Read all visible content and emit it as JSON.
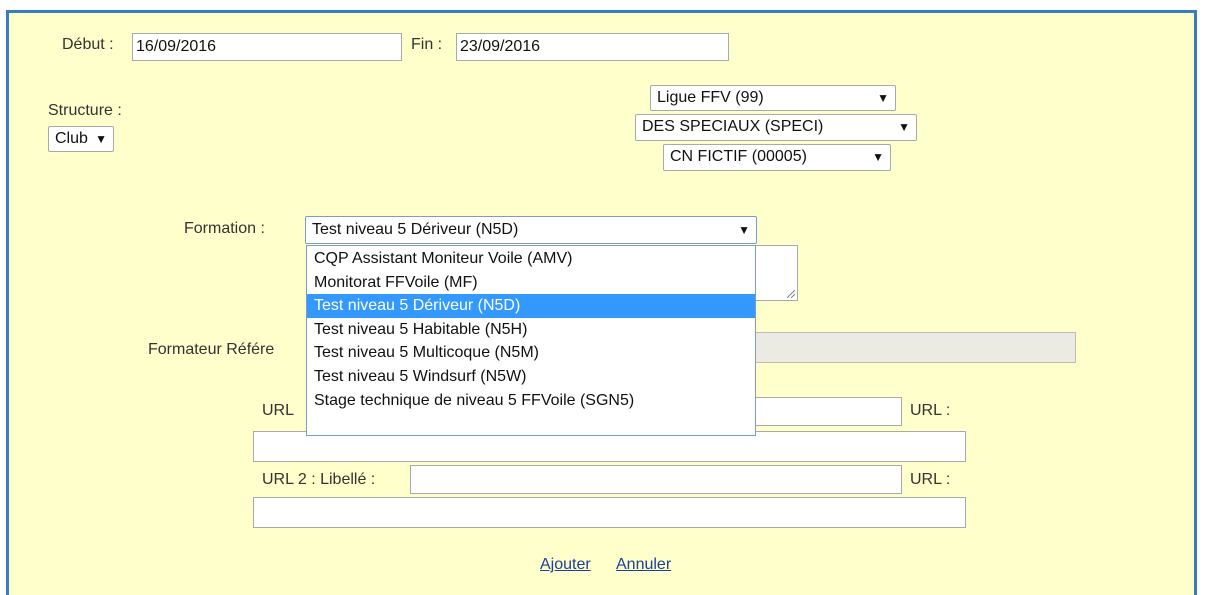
{
  "form": {
    "debut_label": "Début :",
    "debut_value": "16/09/2016",
    "fin_label": "Fin :",
    "fin_value": "23/09/2016",
    "structure_label": "Structure :",
    "structure_value": "Club",
    "ligue_value": "Ligue FFV (99)",
    "departement_value": "DES SPECIAUX (SPECI)",
    "club_value": "CN FICTIF (00005)",
    "formation_label": "Formation :",
    "formation_value": "Test niveau 5 Dériveur (N5D)",
    "formateur_label": "Formateur Référe",
    "url1_label": "URL",
    "url1_right_label": "URL :",
    "url2_label": "URL 2 : Libellé :",
    "url2_right_label": "URL :",
    "add_link": "Ajouter",
    "cancel_link": "Annuler"
  },
  "formation_options": [
    {
      "label": "CQP Assistant Moniteur Voile (AMV)",
      "selected": false
    },
    {
      "label": "Monitorat FFVoile (MF)",
      "selected": false
    },
    {
      "label": "Test niveau 5 Dériveur (N5D)",
      "selected": true
    },
    {
      "label": "Test niveau 5 Habitable (N5H)",
      "selected": false
    },
    {
      "label": "Test niveau 5 Multicoque (N5M)",
      "selected": false
    },
    {
      "label": "Test niveau 5 Windsurf (N5W)",
      "selected": false
    },
    {
      "label": "Stage technique de niveau 5 FFVoile (SGN5)",
      "selected": false
    }
  ],
  "colors": {
    "panel_background": "#ffffcc",
    "panel_border": "#3a7cc0",
    "selection_highlight": "#3399ff",
    "link": "#1a3f9c"
  },
  "icons": {
    "select_arrow": "dropdown-arrow-icon",
    "resize_handle": "resize-grip-icon"
  }
}
